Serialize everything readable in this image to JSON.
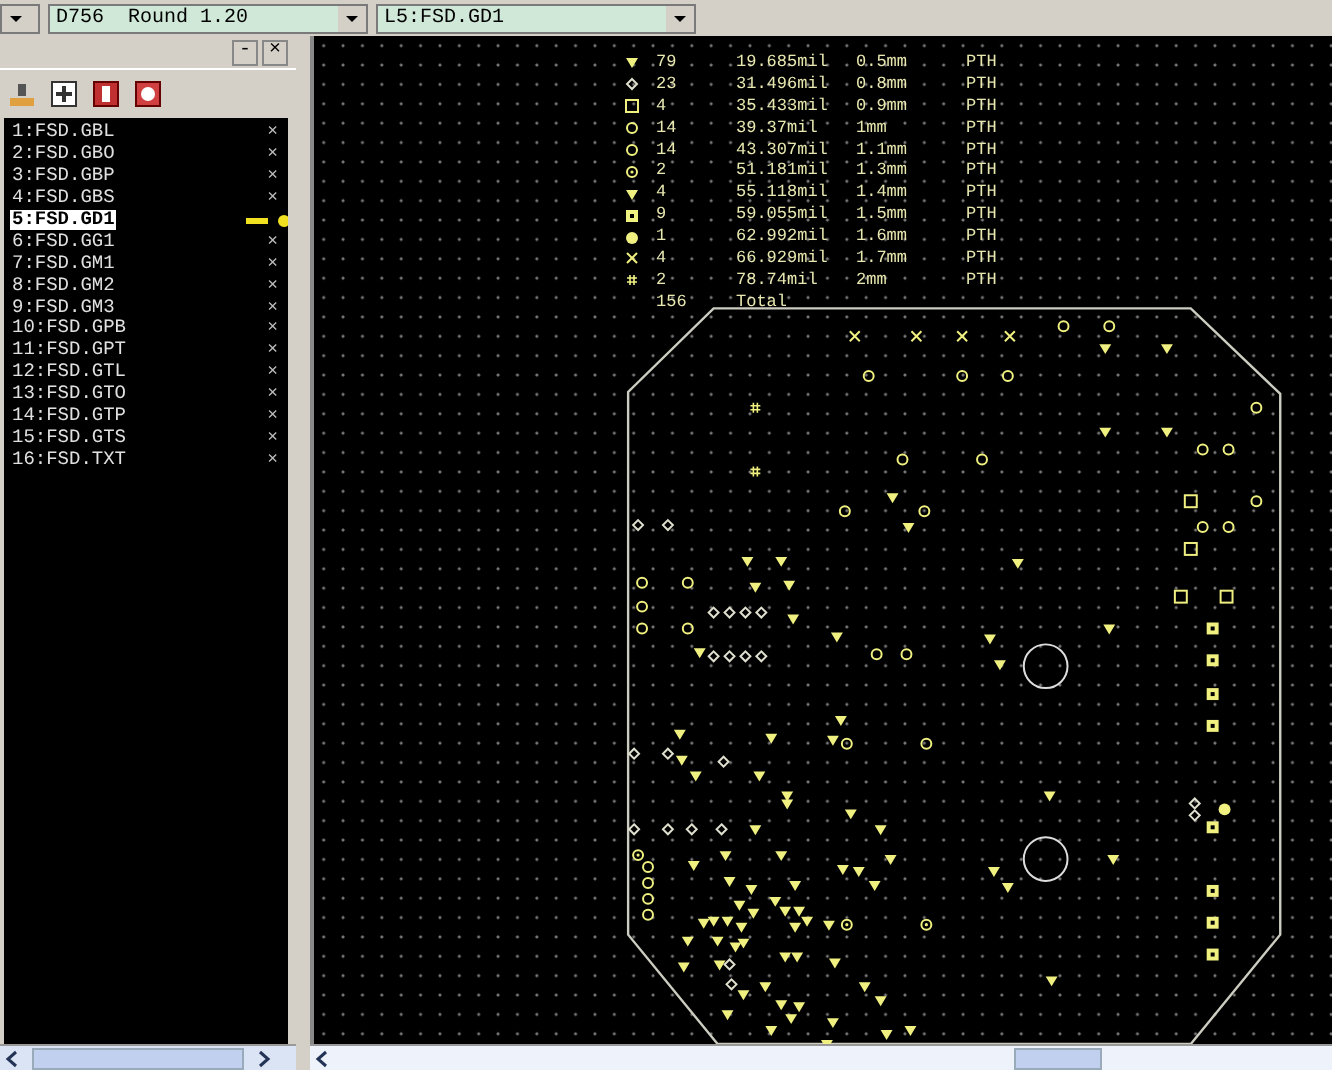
{
  "toolbar": {
    "dropdowns": [
      {
        "value": "D756  Round 1.20"
      },
      {
        "value": "L5:FSD.GD1"
      }
    ]
  },
  "layer_panel": {
    "controls": [
      "-",
      "×"
    ],
    "layers": [
      {
        "label": "1:FSD.GBL",
        "close": "×",
        "selected": false
      },
      {
        "label": "2:FSD.GBO",
        "close": "×",
        "selected": false
      },
      {
        "label": "3:FSD.GBP",
        "close": "×",
        "selected": false
      },
      {
        "label": "4:FSD.GBS",
        "close": "×",
        "selected": false
      },
      {
        "label": "5:FSD.GD1",
        "selected": true
      },
      {
        "label": "6:FSD.GG1",
        "close": "×",
        "selected": false
      },
      {
        "label": "7:FSD.GM1",
        "close": "×",
        "selected": false
      },
      {
        "label": "8:FSD.GM2",
        "close": "×",
        "selected": false
      },
      {
        "label": "9:FSD.GM3",
        "close": "×",
        "selected": false
      },
      {
        "label": "10:FSD.GPB",
        "close": "×",
        "selected": false
      },
      {
        "label": "11:FSD.GPT",
        "close": "×",
        "selected": false
      },
      {
        "label": "12:FSD.GTL",
        "close": "×",
        "selected": false
      },
      {
        "label": "13:FSD.GTO",
        "close": "×",
        "selected": false
      },
      {
        "label": "14:FSD.GTP",
        "close": "×",
        "selected": false
      },
      {
        "label": "15:FSD.GTS",
        "close": "×",
        "selected": false
      },
      {
        "label": "16:FSD.TXT",
        "close": "×",
        "selected": false
      }
    ]
  },
  "drill_table": {
    "rows": [
      {
        "kind": "triangle",
        "count": "79",
        "mil": "19.685mil",
        "mm": "0.5mm",
        "type": "PTH"
      },
      {
        "kind": "diamond",
        "count": "23",
        "mil": "31.496mil",
        "mm": "0.8mm",
        "type": "PTH"
      },
      {
        "kind": "square",
        "count": "4",
        "mil": "35.433mil",
        "mm": "0.9mm",
        "type": "PTH"
      },
      {
        "kind": "circle",
        "count": "14",
        "mil": "39.37mil",
        "mm": "1mm",
        "type": "PTH"
      },
      {
        "kind": "circle",
        "count": "14",
        "mil": "43.307mil",
        "mm": "1.1mm",
        "type": "PTH"
      },
      {
        "kind": "target",
        "count": "2",
        "mil": "51.181mil",
        "mm": "1.3mm",
        "type": "PTH"
      },
      {
        "kind": "triangle",
        "count": "4",
        "mil": "55.118mil",
        "mm": "1.4mm",
        "type": "PTH"
      },
      {
        "kind": "filled-square",
        "count": "9",
        "mil": "59.055mil",
        "mm": "1.5mm",
        "type": "PTH"
      },
      {
        "kind": "filled-circle",
        "count": "1",
        "mil": "62.992mil",
        "mm": "1.6mm",
        "type": "PTH"
      },
      {
        "kind": "cross",
        "count": "4",
        "mil": "66.929mil",
        "mm": "1.7mm",
        "type": "PTH"
      },
      {
        "kind": "hash",
        "count": "2",
        "mil": "78.74mil",
        "mm": "2mm",
        "type": "PTH"
      }
    ],
    "total": {
      "count": "156",
      "label": "Total"
    }
  }
}
